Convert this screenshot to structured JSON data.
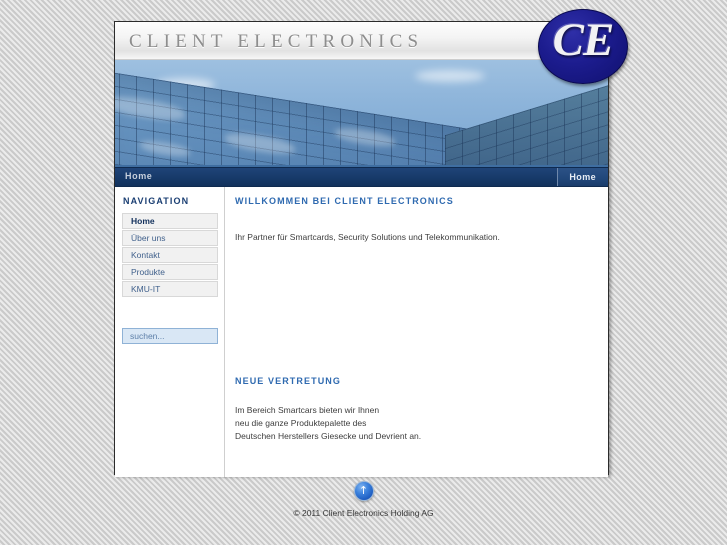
{
  "site": {
    "brand_title": "CLIENT ELECTRONICS",
    "logo_text": "CE"
  },
  "navbar": {
    "breadcrumb": "Home",
    "home_button": "Home"
  },
  "sidebar": {
    "heading": "NAVIGATION",
    "items": [
      {
        "label": "Home",
        "active": true
      },
      {
        "label": "Über uns",
        "active": false
      },
      {
        "label": "Kontakt",
        "active": false
      },
      {
        "label": "Produkte",
        "active": false
      },
      {
        "label": "KMU-IT",
        "active": false
      }
    ],
    "search": {
      "value": "",
      "placeholder": "suchen..."
    }
  },
  "main": {
    "welcome_heading": "WILLKOMMEN BEI CLIENT ELECTRONICS",
    "welcome_text": "Ihr Partner für Smartcards, Security Solutions und Telekommunikation.",
    "vertretung_heading": "NEUE VERTRETUNG",
    "vertretung_line1": "Im Bereich Smartcars bieten wir Ihnen",
    "vertretung_line2": "neu die ganze Produktepalette des",
    "vertretung_line3": "Deutschen Herstellers Giesecke und Devrient an."
  },
  "footer": {
    "top_icon": "up-arrow-icon",
    "top_arrow_glyph": "↑",
    "copyright": "© 2011 Client Electronics Holding AG"
  },
  "colors": {
    "navy": "#173a69",
    "accent_blue": "#2f6ab0",
    "logo_blue": "#1c1c8e",
    "page_bg": "#d3d3d3"
  }
}
